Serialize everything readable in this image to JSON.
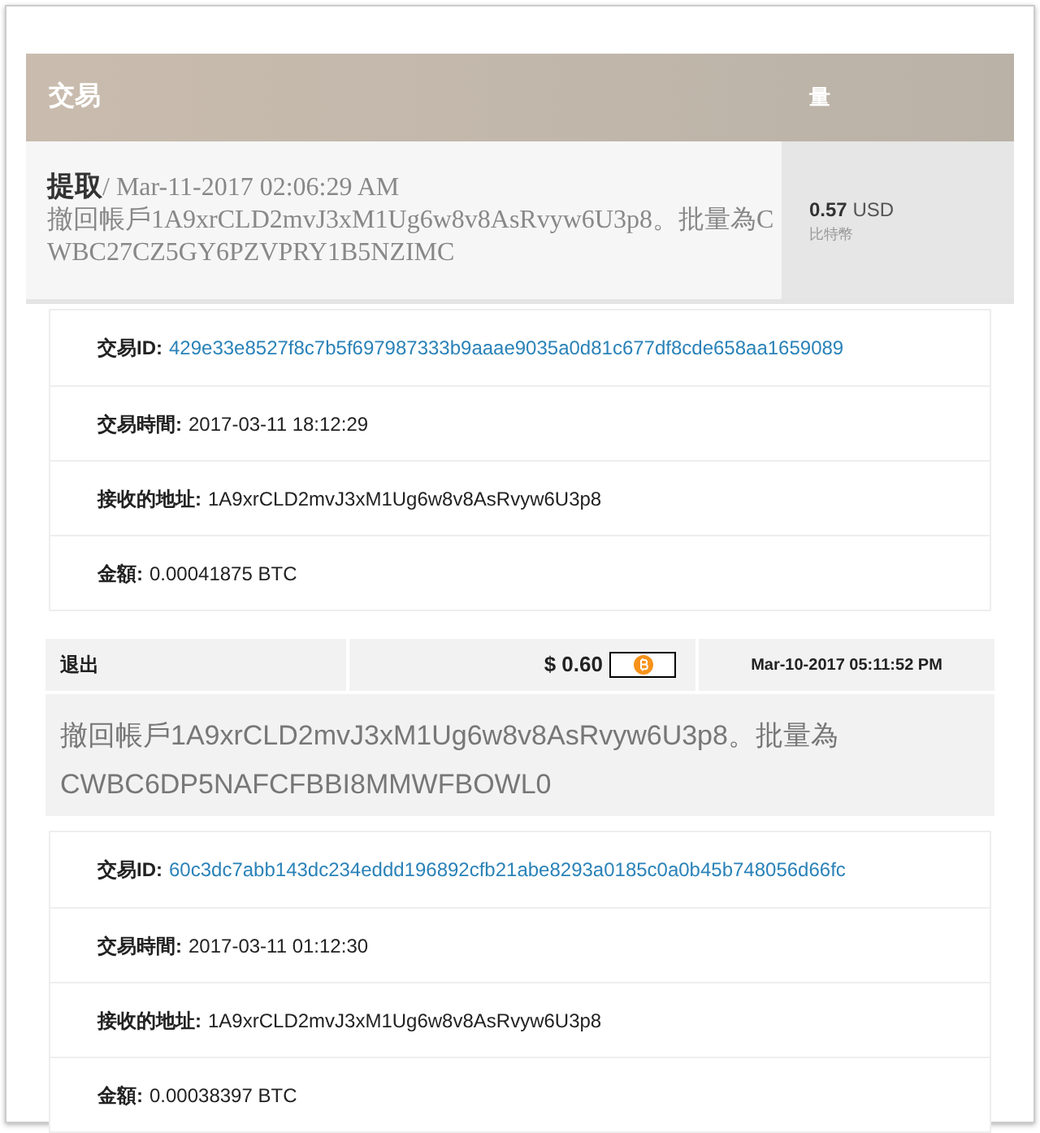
{
  "table": {
    "columns": [
      "交易",
      "量"
    ],
    "row": {
      "type": "提取",
      "date": "/ Mar-11-2017 02:06:29 AM",
      "description": "撤回帳戶1A9xrCLD2mvJ3xM1Ug6w8v8AsRvyw6U3p8。批量為CWBC27CZ5GY6PZVPRY1B5NZIMC",
      "amount": "0.57",
      "currency": "USD",
      "coin": "比特幣"
    }
  },
  "details_1": [
    {
      "kind": "link",
      "label": "交易ID:",
      "value": "429e33e8527f8c7b5f697987333b9aaae9035a0d81c677df8cde658aa1659089"
    },
    {
      "kind": "text",
      "label": "交易時間:",
      "value": "2017-03-11 18:12:29"
    },
    {
      "kind": "text",
      "label": "接收的地址:",
      "value": "1A9xrCLD2mvJ3xM1Ug6w8v8AsRvyw6U3p8"
    },
    {
      "kind": "text",
      "label": "金額:",
      "value": "0.00041875 BTC"
    }
  ],
  "withdrawal": {
    "type": "退出",
    "amount": "$ 0.60",
    "date": "Mar-10-2017 05:11:52 PM",
    "description_lines": [
      "撤回帳戶1A9xrCLD2mvJ3xM1Ug6w8v8AsRvyw6U3p8。批量為",
      "CWBC6DP5NAFCFBBI8MMWFBOWL0"
    ]
  },
  "details_2": [
    {
      "kind": "link",
      "label": "交易ID:",
      "value": "60c3dc7abb143dc234eddd196892cfb21abe8293a0185c0a0b45b748056d66fc"
    },
    {
      "kind": "text",
      "label": "交易時間:",
      "value": "2017-03-11 01:12:30"
    },
    {
      "kind": "text",
      "label": "接收的地址:",
      "value": "1A9xrCLD2mvJ3xM1Ug6w8v8AsRvyw6U3p8"
    },
    {
      "kind": "text",
      "label": "金額:",
      "value": "0.00038397 BTC"
    }
  ]
}
